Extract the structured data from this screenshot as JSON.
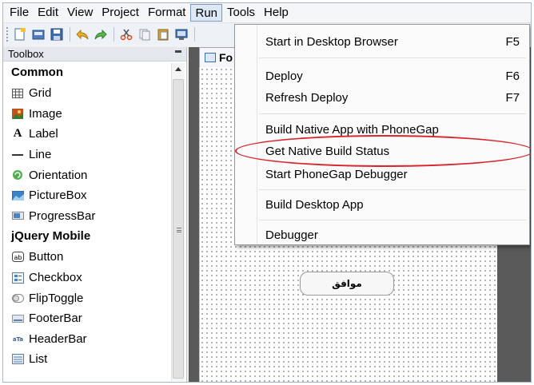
{
  "menubar": {
    "items": [
      "File",
      "Edit",
      "View",
      "Project",
      "Format",
      "Run",
      "Tools",
      "Help"
    ]
  },
  "toolbox": {
    "title": "Toolbox",
    "groups": [
      {
        "title": "Common",
        "items": [
          {
            "label": "Grid",
            "icon": "grid-icon"
          },
          {
            "label": "Image",
            "icon": "image-icon"
          },
          {
            "label": "Label",
            "icon": "label-icon"
          },
          {
            "label": "Line",
            "icon": "line-icon"
          },
          {
            "label": "Orientation",
            "icon": "orientation-icon"
          },
          {
            "label": "PictureBox",
            "icon": "picturebox-icon"
          },
          {
            "label": "ProgressBar",
            "icon": "progressbar-icon"
          }
        ]
      },
      {
        "title": "jQuery Mobile",
        "items": [
          {
            "label": "Button",
            "icon": "button-icon"
          },
          {
            "label": "Checkbox",
            "icon": "checkbox-icon"
          },
          {
            "label": "FlipToggle",
            "icon": "fliptoggle-icon"
          },
          {
            "label": "FooterBar",
            "icon": "footerbar-icon"
          },
          {
            "label": "HeaderBar",
            "icon": "headerbar-icon"
          },
          {
            "label": "List",
            "icon": "list-icon"
          }
        ]
      }
    ]
  },
  "designer": {
    "tab_label": "Fo",
    "form_button_label": "موافق"
  },
  "run_menu": {
    "items": [
      {
        "label": "Start in Desktop Browser",
        "shortcut": "F5"
      },
      {
        "label": "Deploy",
        "shortcut": "F6"
      },
      {
        "label": "Refresh Deploy",
        "shortcut": "F7"
      },
      {
        "label": "Build Native App with PhoneGap",
        "shortcut": ""
      },
      {
        "label": "Get Native Build Status",
        "shortcut": ""
      },
      {
        "label": "Start PhoneGap Debugger",
        "shortcut": ""
      },
      {
        "label": "Build Desktop App",
        "shortcut": ""
      },
      {
        "label": "Debugger",
        "shortcut": ""
      }
    ],
    "highlight_color": "#d6262e"
  },
  "colors": {
    "menu_active_bg": "#dde8f6",
    "menu_active_border": "#7b99c4",
    "designer_bg": "#5a5a5a"
  }
}
